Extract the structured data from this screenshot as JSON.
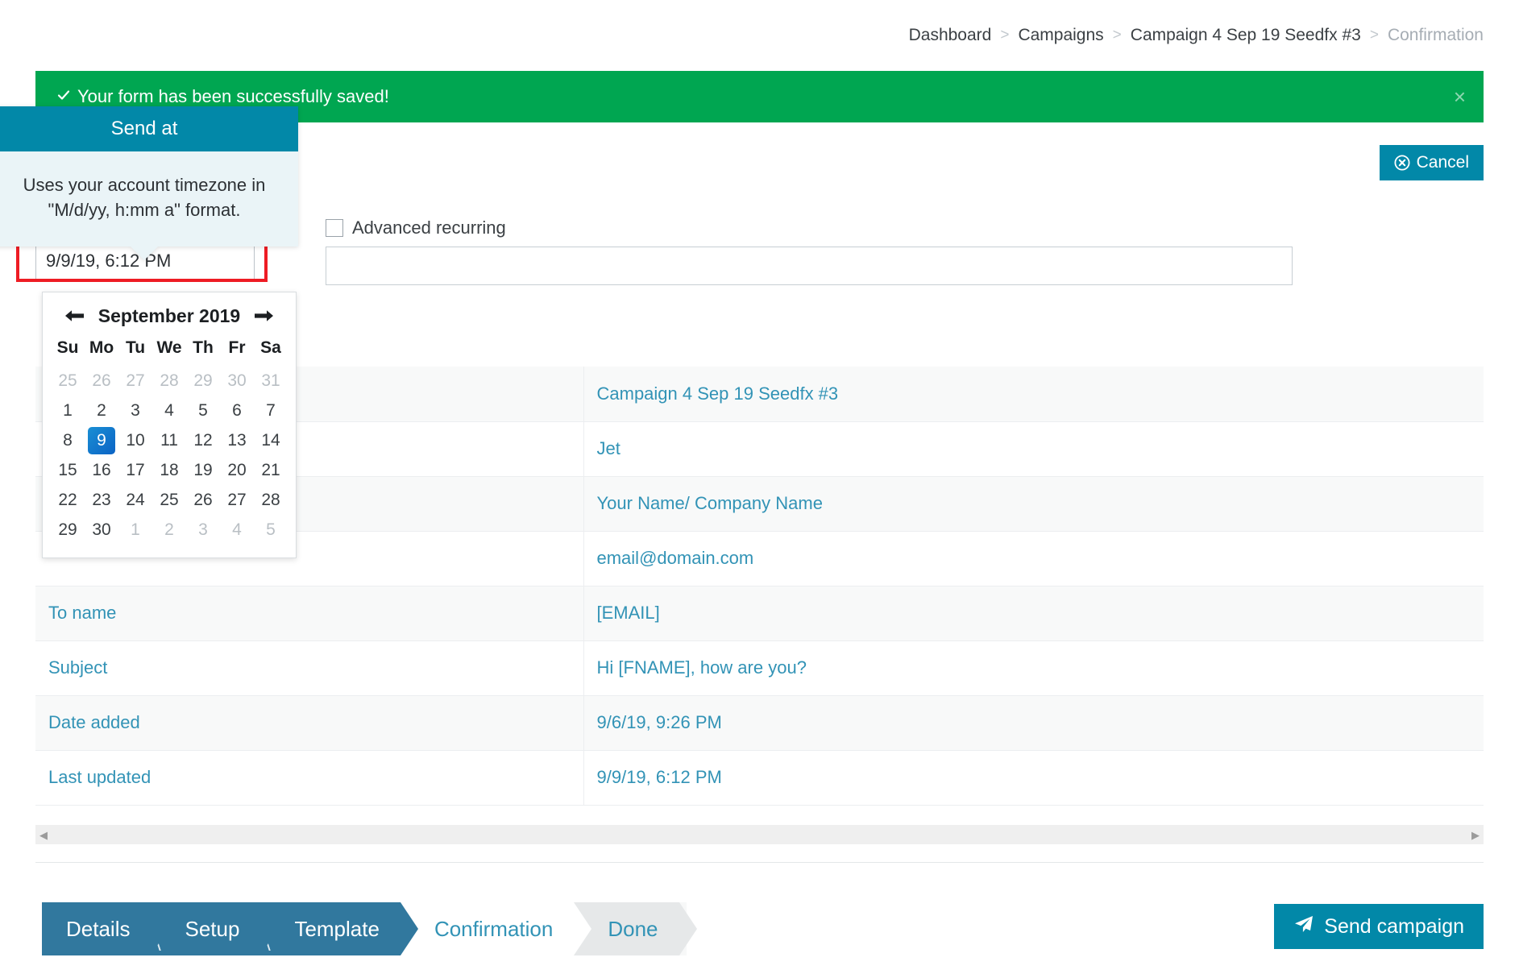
{
  "breadcrumb": {
    "items": [
      {
        "label": "Dashboard",
        "current": false
      },
      {
        "label": "Campaigns",
        "current": false
      },
      {
        "label": "Campaign 4 Sep 19 Seedfx #3",
        "current": false
      },
      {
        "label": "Confirmation",
        "current": true
      }
    ],
    "separator": ">"
  },
  "alert": {
    "check_icon": "check-icon",
    "message": "Your form has been successfully saved!",
    "close_label": "×",
    "color": "#00a651"
  },
  "header": {
    "title": "Confirmation",
    "cancel_label": "Cancel",
    "cancel_icon": "circle-x-icon"
  },
  "form": {
    "send_at": {
      "label": "Send at",
      "required_mark": "*",
      "value": "9/9/19, 6:12 PM"
    },
    "advanced_recurring": {
      "label": "Advanced recurring",
      "checked": false,
      "value": ""
    }
  },
  "tooltip": {
    "title": "Send at",
    "body": "Uses your account timezone in \"M/d/yy, h:mm a\" format.",
    "header_color": "#0288a8",
    "body_color": "#eaf4f7"
  },
  "datepicker": {
    "prev_icon": "arrow-left-icon",
    "next_icon": "arrow-right-icon",
    "month_title": "September 2019",
    "weekdays": [
      "Su",
      "Mo",
      "Tu",
      "We",
      "Th",
      "Fr",
      "Sa"
    ],
    "selected_day": 9,
    "weeks": [
      [
        {
          "d": "25",
          "muted": true
        },
        {
          "d": "26",
          "muted": true
        },
        {
          "d": "27",
          "muted": true
        },
        {
          "d": "28",
          "muted": true
        },
        {
          "d": "29",
          "muted": true
        },
        {
          "d": "30",
          "muted": true
        },
        {
          "d": "31",
          "muted": true
        }
      ],
      [
        {
          "d": "1",
          "muted": false
        },
        {
          "d": "2",
          "muted": false
        },
        {
          "d": "3",
          "muted": false
        },
        {
          "d": "4",
          "muted": false
        },
        {
          "d": "5",
          "muted": false
        },
        {
          "d": "6",
          "muted": false
        },
        {
          "d": "7",
          "muted": false
        }
      ],
      [
        {
          "d": "8",
          "muted": false
        },
        {
          "d": "9",
          "muted": false,
          "selected": true
        },
        {
          "d": "10",
          "muted": false
        },
        {
          "d": "11",
          "muted": false
        },
        {
          "d": "12",
          "muted": false
        },
        {
          "d": "13",
          "muted": false
        },
        {
          "d": "14",
          "muted": false
        }
      ],
      [
        {
          "d": "15",
          "muted": false
        },
        {
          "d": "16",
          "muted": false
        },
        {
          "d": "17",
          "muted": false
        },
        {
          "d": "18",
          "muted": false
        },
        {
          "d": "19",
          "muted": false
        },
        {
          "d": "20",
          "muted": false
        },
        {
          "d": "21",
          "muted": false
        }
      ],
      [
        {
          "d": "22",
          "muted": false
        },
        {
          "d": "23",
          "muted": false
        },
        {
          "d": "24",
          "muted": false
        },
        {
          "d": "25",
          "muted": false
        },
        {
          "d": "26",
          "muted": false
        },
        {
          "d": "27",
          "muted": false
        },
        {
          "d": "28",
          "muted": false
        }
      ],
      [
        {
          "d": "29",
          "muted": false
        },
        {
          "d": "30",
          "muted": false
        },
        {
          "d": "1",
          "muted": true
        },
        {
          "d": "2",
          "muted": true
        },
        {
          "d": "3",
          "muted": true
        },
        {
          "d": "4",
          "muted": true
        },
        {
          "d": "5",
          "muted": true
        }
      ]
    ]
  },
  "details_table": {
    "rows": [
      {
        "key": "",
        "value": "Campaign 4 Sep 19 Seedfx #3"
      },
      {
        "key": "",
        "value": "Jet"
      },
      {
        "key": "",
        "value": "Your Name/ Company Name"
      },
      {
        "key": "",
        "value": "email@domain.com"
      },
      {
        "key": "To name",
        "value": "[EMAIL]"
      },
      {
        "key": "Subject",
        "value": "Hi [FNAME], how are you?"
      },
      {
        "key": "Date added",
        "value": "9/6/19, 9:26 PM"
      },
      {
        "key": "Last updated",
        "value": "9/9/19, 6:12 PM"
      }
    ]
  },
  "scrollbar": {
    "left_arrow": "◀",
    "right_arrow": "▶"
  },
  "wizard": {
    "steps": [
      {
        "label": "Details",
        "state": "active"
      },
      {
        "label": "Setup",
        "state": "active"
      },
      {
        "label": "Template",
        "state": "active"
      },
      {
        "label": "Confirmation",
        "state": "upcoming"
      },
      {
        "label": "Done",
        "state": "gray"
      }
    ],
    "active_color": "#31789e",
    "link_color": "#3293b6"
  },
  "send_button": {
    "label": "Send campaign",
    "icon": "paper-plane-icon",
    "color": "#0288a8"
  }
}
